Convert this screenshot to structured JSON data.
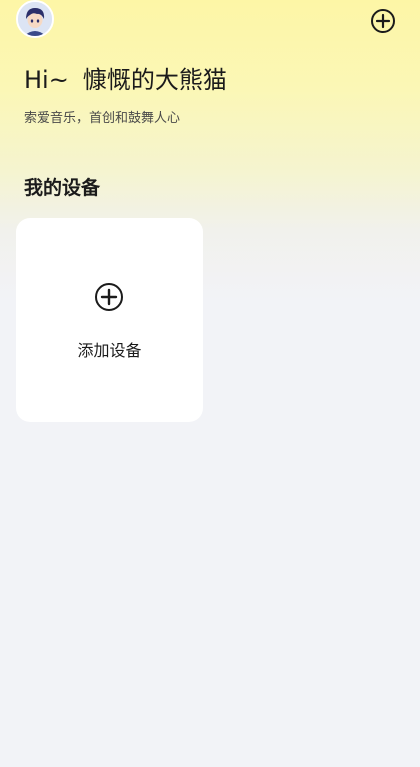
{
  "header": {
    "avatar_icon": "user-avatar",
    "add_icon": "plus-circle-icon"
  },
  "greeting": {
    "prefix": "Hi~",
    "username": "慷慨的大熊猫"
  },
  "subtitle": "索爱音乐，首创和鼓舞人心",
  "devices": {
    "section_title": "我的设备",
    "add_card": {
      "icon": "plus-circle-icon",
      "label": "添加设备"
    }
  },
  "colors": {
    "bg_top": "#fdf6a6",
    "bg_bottom": "#f2f3f7",
    "card": "#ffffff",
    "text": "#1b1b1b"
  }
}
